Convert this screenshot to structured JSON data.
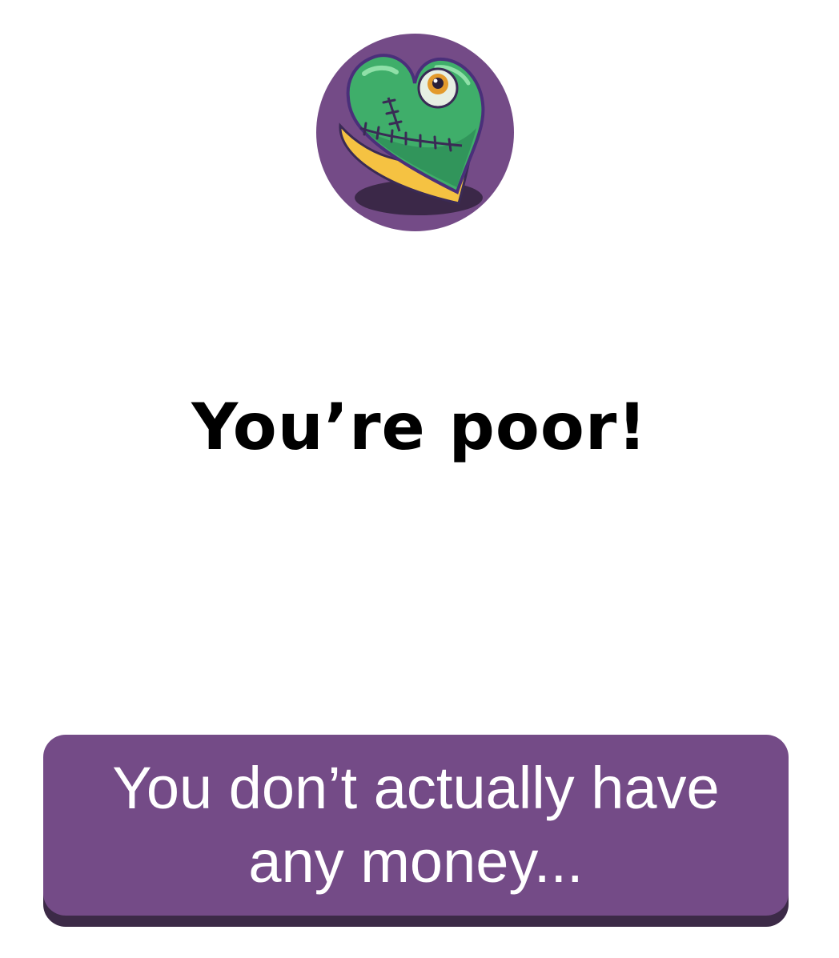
{
  "badge": {
    "icon": "stitched-green-heart-with-eye-icon",
    "background": "#744b87"
  },
  "title": "You’re poor!",
  "answer": {
    "label": "You don’t actually have any money...",
    "background": "#744b87",
    "shadow": "#3c2a47"
  }
}
